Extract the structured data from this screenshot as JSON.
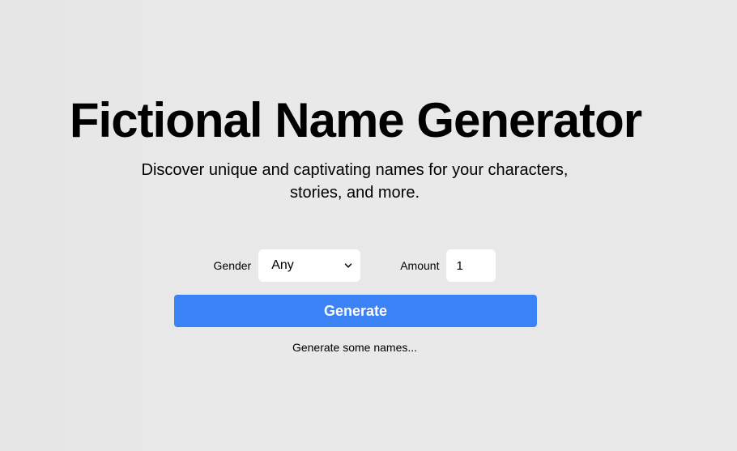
{
  "header": {
    "title": "Fictional Name Generator",
    "subtitle": "Discover unique and captivating names for your characters, stories, and more."
  },
  "form": {
    "gender_label": "Gender",
    "gender_value": "Any",
    "gender_icon": "chevron-down-icon",
    "amount_label": "Amount",
    "amount_value": "1",
    "generate_label": "Generate"
  },
  "status": {
    "text": "Generate some names..."
  },
  "colors": {
    "background": "#e8e8e8",
    "accent": "#3b82f6",
    "input_bg": "#ffffff"
  }
}
